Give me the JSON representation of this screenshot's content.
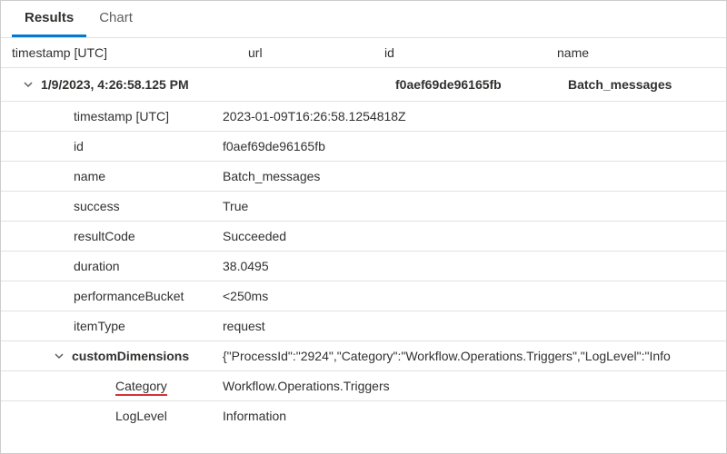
{
  "tabs": {
    "results": "Results",
    "chart": "Chart"
  },
  "columns": {
    "timestamp": "timestamp [UTC]",
    "url": "url",
    "id": "id",
    "name": "name"
  },
  "group": {
    "timestamp": "1/9/2023, 4:26:58.125 PM",
    "url": "",
    "id": "f0aef69de96165fb",
    "name": "Batch_messages"
  },
  "details": [
    {
      "label": "timestamp [UTC]",
      "value": "2023-01-09T16:26:58.1254818Z"
    },
    {
      "label": "id",
      "value": "f0aef69de96165fb"
    },
    {
      "label": "name",
      "value": "Batch_messages"
    },
    {
      "label": "success",
      "value": "True"
    },
    {
      "label": "resultCode",
      "value": "Succeeded"
    },
    {
      "label": "duration",
      "value": "38.0495"
    },
    {
      "label": "performanceBucket",
      "value": "<250ms"
    },
    {
      "label": "itemType",
      "value": "request"
    }
  ],
  "customDimensions": {
    "label": "customDimensions",
    "json": "{\"ProcessId\":\"2924\",\"Category\":\"Workflow.Operations.Triggers\",\"LogLevel\":\"Info",
    "children": [
      {
        "label": "Category",
        "value": "Workflow.Operations.Triggers",
        "highlight": true
      },
      {
        "label": "LogLevel",
        "value": "Information"
      }
    ]
  }
}
